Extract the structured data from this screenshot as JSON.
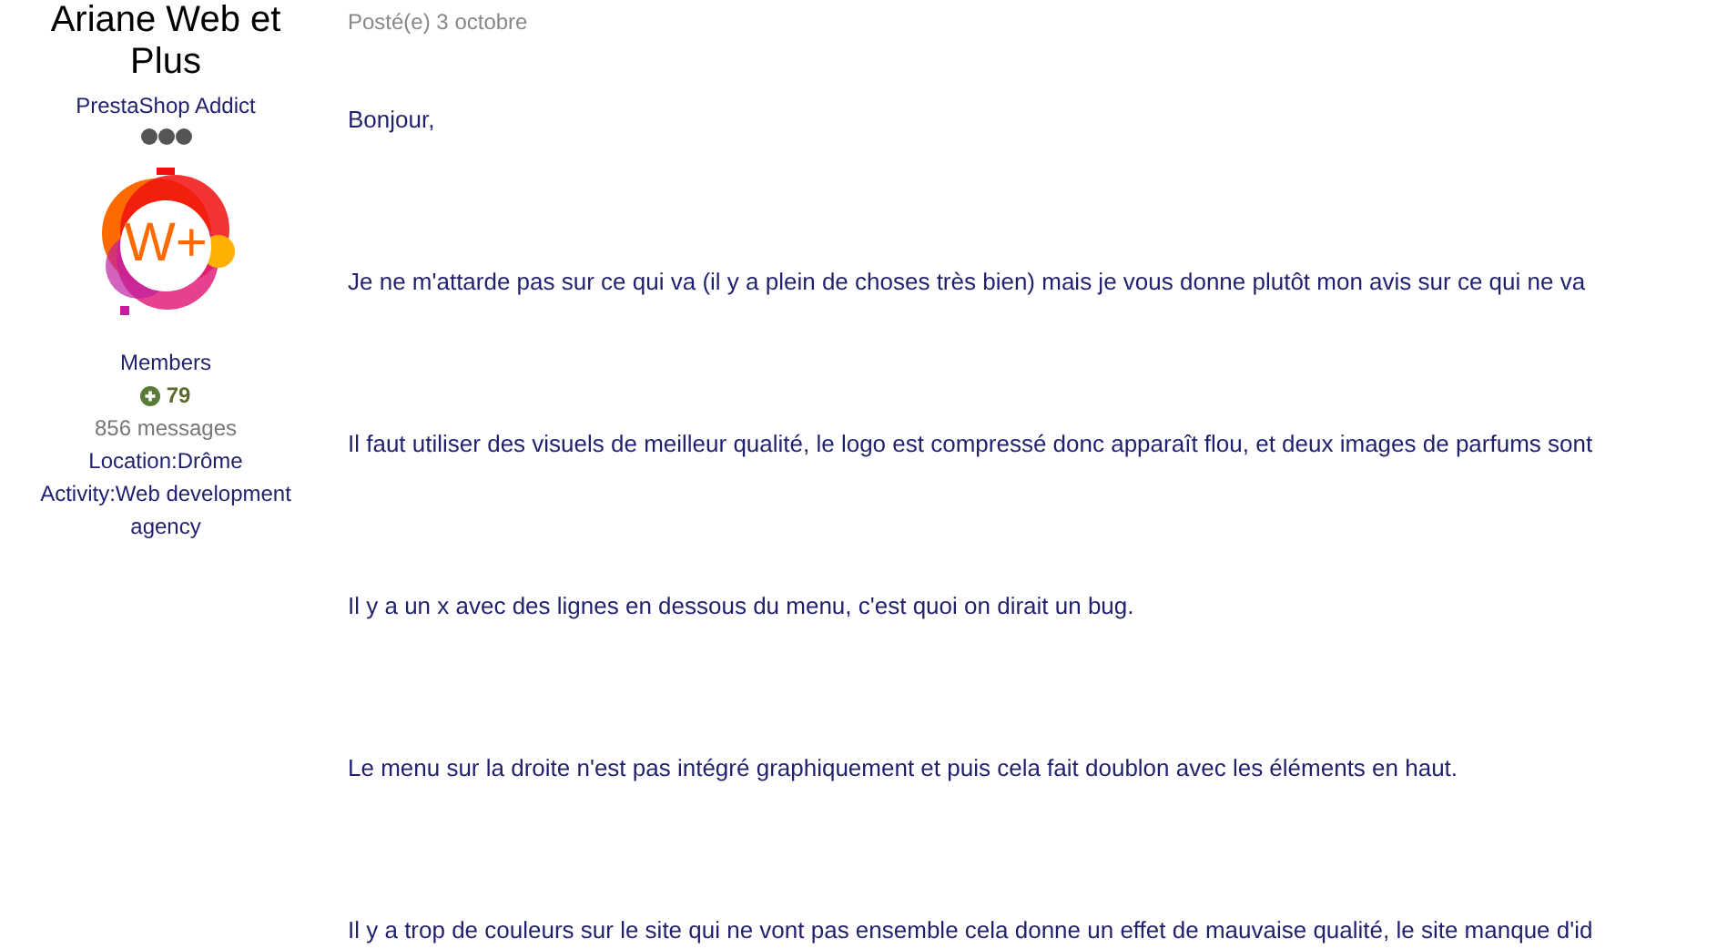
{
  "author": {
    "name": "Ariane Web et Plus",
    "rank": "PrestaShop Addict",
    "logo_text": "W+",
    "group": "Members",
    "reputation": "79",
    "posts": "856 messages",
    "location": "Location:Drôme",
    "activity": "Activity:Web development agency"
  },
  "post": {
    "date": "Posté(e) 3 octobre",
    "paragraphs": [
      "Bonjour,",
      "Je ne m'attarde pas sur ce qui va (il y a plein de choses très bien) mais je vous donne plutôt mon avis sur ce qui ne va",
      "Il faut utiliser des visuels de meilleur qualité, le logo est compressé donc apparaît flou, et deux images de parfums sont",
      "Il y a un x avec des lignes en dessous du menu, c'est quoi on dirait un bug.",
      "Le menu sur la droite n'est pas intégré graphiquement et puis cela fait doublon avec les éléments en haut.",
      "Il y a trop de couleurs sur le site qui ne vont pas ensemble cela donne un effet de mauvaise qualité, le site manque d'id"
    ]
  }
}
